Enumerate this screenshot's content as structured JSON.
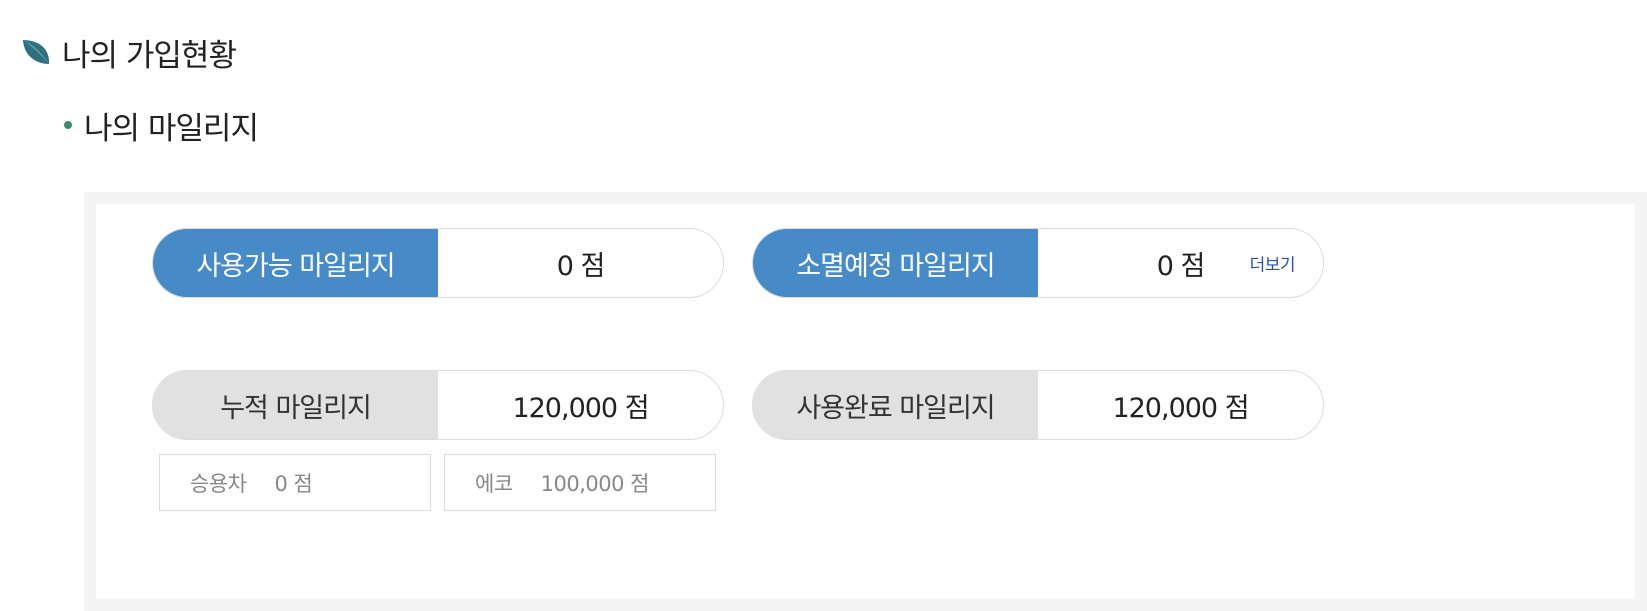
{
  "section": {
    "title": "나의 가입현황",
    "icon": "leaf-icon"
  },
  "subsection": {
    "title": "나의 마일리지"
  },
  "colors": {
    "accent_blue": "#468bc8",
    "label_gray": "#e1e1e1",
    "link_blue": "#2d4fb8",
    "bullet_green": "#3a8a6e"
  },
  "mileage": {
    "available": {
      "label": "사용가능 마일리지",
      "value": "0 점"
    },
    "expiring": {
      "label": "소멸예정 마일리지",
      "value": "0 점",
      "more_label": "더보기"
    },
    "accumulated": {
      "label": "누적 마일리지",
      "value": "120,000 점"
    },
    "used": {
      "label": "사용완료 마일리지",
      "value": "120,000 점"
    },
    "breakdown": [
      {
        "label": "승용차",
        "value": "0 점"
      },
      {
        "label": "에코",
        "value": "100,000 점"
      }
    ]
  }
}
